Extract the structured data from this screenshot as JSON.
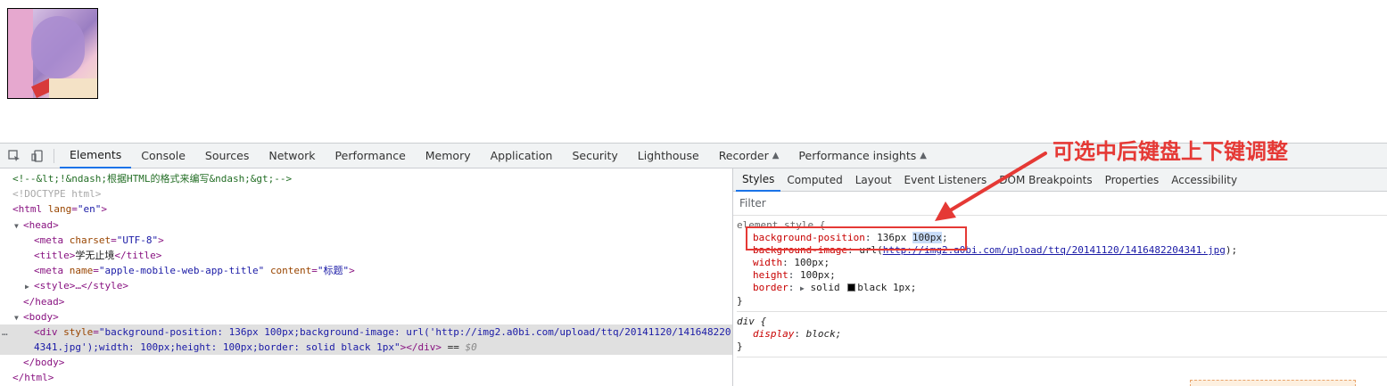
{
  "annotation": {
    "text": "可选中后键盘上下键调整",
    "color": "#e53935"
  },
  "devtools": {
    "tabs": [
      "Elements",
      "Console",
      "Sources",
      "Network",
      "Performance",
      "Memory",
      "Application",
      "Security",
      "Lighthouse",
      "Recorder",
      "Performance insights"
    ],
    "active_tab": "Elements",
    "styles_tabs": [
      "Styles",
      "Computed",
      "Layout",
      "Event Listeners",
      "DOM Breakpoints",
      "Properties",
      "Accessibility"
    ],
    "filter_placeholder": "Filter",
    "dom": {
      "comment": "<!--&lt;!&ndash;根据HTML的格式来编写&ndash;&gt;-->",
      "doctype": "<!DOCTYPE html>",
      "html_open": "<html",
      "lang_attr": "lang",
      "lang_val": "\"en\"",
      "head_open": "<head>",
      "meta1_open": "<meta",
      "meta1_attr": "charset",
      "meta1_val": "\"UTF-8\"",
      "title_open": "<title>",
      "title_text": "学无止境",
      "title_close": "</title>",
      "meta2_open": "<meta",
      "meta2_attr1": "name",
      "meta2_val1": "\"apple-mobile-web-app-title\"",
      "meta2_attr2": "content",
      "meta2_val2": "\"标题\"",
      "style_collapsed": "<style>…</style>",
      "head_close": "</head>",
      "body_open": "<body>",
      "div_open": "<div",
      "div_style_attr": "style",
      "div_style_val_l1": "\"background-position: 136px 100px;background-image: url('http://img2.a0bi.com/upload/ttq/20141120/141648220",
      "div_style_val_l2": "4341.jpg');width: 100px;height: 100px;border: solid black 1px\"",
      "div_close": "></div>",
      "eq0": " == ",
      "dollar0": "$0",
      "body_close": "</body>",
      "html_close": "</html>"
    },
    "styles": {
      "element_selector": "element.style {",
      "bg_pos_prop": "background-position",
      "bg_pos_val_a": "136px",
      "bg_pos_val_b": "100px",
      "bg_img_prop": "background-image",
      "bg_img_url_prefix": "url(",
      "bg_img_url": "http://img2.a0bi.com/upload/ttq/20141120/1416482204341.jpg",
      "bg_img_url_suffix": ");",
      "width_prop": "width",
      "width_val": "100px;",
      "height_prop": "height",
      "height_val": "100px;",
      "border_prop": "border",
      "border_val_a": "solid",
      "border_val_b": "black 1px;",
      "close_brace": "}",
      "div_selector": "div {",
      "display_prop": "display",
      "display_val": "block;"
    }
  }
}
